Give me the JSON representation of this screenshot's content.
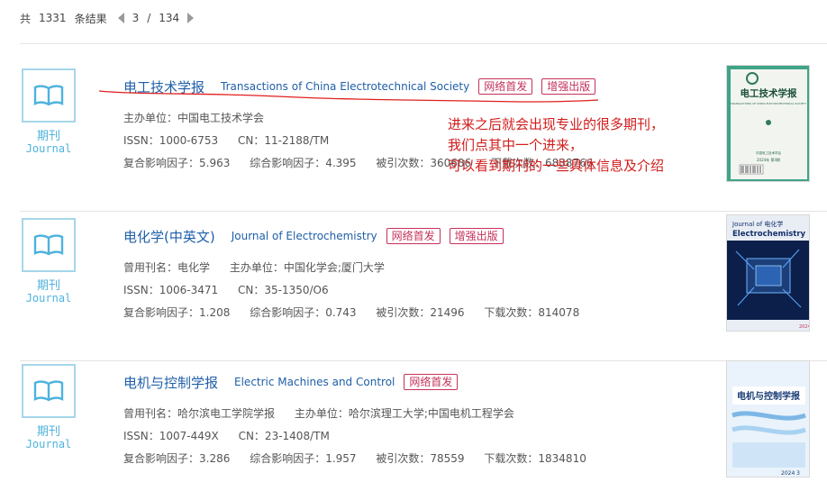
{
  "pager": {
    "total_prefix": "共",
    "total": "1331",
    "total_suffix": "条结果",
    "current": "3",
    "sep": "/",
    "pages": "134"
  },
  "badge": {
    "cn": "期刊",
    "en": "Journal",
    "icon": "open-book-icon"
  },
  "journals": [
    {
      "title_cn": "电工技术学报",
      "title_en": "Transactions of China Electrotechnical Society",
      "tags": [
        "网络首发",
        "增强出版"
      ],
      "line1": [
        "主办单位：中国电工技术学会"
      ],
      "issn": "ISSN：1000-6753",
      "cn": "CN：11-2188/TM",
      "metrics": [
        "复合影响因子：5.963",
        "综合影响因子：4.395",
        "被引次数：360686",
        "下载次数：6838766"
      ]
    },
    {
      "title_cn": "电化学(中英文)",
      "title_en": "Journal of Electrochemistry",
      "tags": [
        "网络首发",
        "增强出版"
      ],
      "line1": [
        "曾用刊名：电化学",
        "主办单位：中国化学会;厦门大学"
      ],
      "issn": "ISSN：1006-3471",
      "cn": "CN：35-1350/O6",
      "metrics": [
        "复合影响因子：1.208",
        "综合影响因子：0.743",
        "被引次数：21496",
        "下载次数：814078"
      ]
    },
    {
      "title_cn": "电机与控制学报",
      "title_en": "Electric Machines and Control",
      "tags": [
        "网络首发"
      ],
      "line1": [
        "曾用刊名：哈尔滨电工学院学报",
        "主办单位：哈尔滨理工大学;中国电机工程学会"
      ],
      "issn": "ISSN：1007-449X",
      "cn": "CN：23-1408/TM",
      "metrics": [
        "复合影响因子：3.286",
        "综合影响因子：1.957",
        "被引次数：78559",
        "下载次数：1834810"
      ]
    }
  ],
  "covers": [
    {
      "title": "电工技术学报",
      "subtitle": "TRANSACTIONS OF CHINA ELECTROTECHNICAL SOCIETY",
      "issue": "2024年 第4期",
      "publisher": "中国电工技术学会"
    },
    {
      "title_top": "Journal of 电化学",
      "title": "Electrochemistry",
      "year": "2024"
    },
    {
      "title": "电机与控制学报",
      "year": "2024 3"
    }
  ],
  "annotation": {
    "lines": [
      "进来之后就会出现专业的很多期刊，",
      "我们点其中一个进来，",
      "可以看到期刊的一些具体信息及介绍"
    ],
    "color": "#d21c1c"
  },
  "colors": {
    "link": "#1f5fa8",
    "tag": "#c5315a",
    "badge": "#4eb3dd"
  }
}
